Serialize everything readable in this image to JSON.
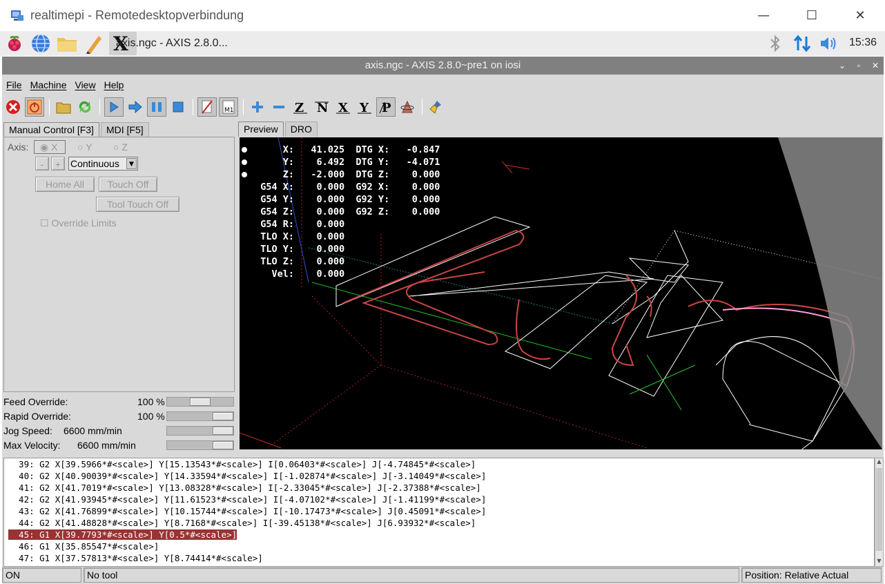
{
  "rdp_window": {
    "title": "realtimepi - Remotedesktopverbindung",
    "minimize": "—",
    "maximize": "☐",
    "close": "✕"
  },
  "taskbar": {
    "task_label": "axis.ngc - AXIS 2.8.0...",
    "clock": "15:36"
  },
  "window": {
    "title": "axis.ngc - AXIS 2.8.0~pre1 on iosi"
  },
  "menu": {
    "file": "File",
    "machine": "Machine",
    "view": "View",
    "help": "Help"
  },
  "left_tabs": {
    "manual": "Manual Control [F3]",
    "mdi": "MDI [F5]"
  },
  "manual": {
    "axis_label": "Axis:",
    "axes": [
      "X",
      "Y",
      "Z"
    ],
    "minus": "-",
    "plus": "+",
    "jog_mode": "Continuous",
    "home_all": "Home All",
    "touch_off": "Touch Off",
    "tool_touch_off": "Tool Touch Off",
    "override_limits": "Override Limits"
  },
  "overrides": {
    "feed_label": "Feed Override:",
    "feed_value": "100 %",
    "feed_fraction": 0.5,
    "rapid_label": "Rapid Override:",
    "rapid_value": "100 %",
    "rapid_fraction": 1.0,
    "jog_label": "Jog Speed:",
    "jog_value": "6600 mm/min",
    "jog_fraction": 1.0,
    "maxvel_label": "Max Velocity:",
    "maxvel_value": "6600 mm/min",
    "maxvel_fraction": 1.0
  },
  "right_tabs": {
    "preview": "Preview",
    "dro": "DRO"
  },
  "dro_lines": [
    "      X:   41.025  DTG X:   -0.847",
    "      Y:    6.492  DTG Y:   -4.071",
    "      Z:   -2.000  DTG Z:    0.000",
    "  G54 X:    0.000  G92 X:    0.000",
    "  G54 Y:    0.000  G92 Y:    0.000",
    "  G54 Z:    0.000  G92 Z:    0.000",
    "  G54 R:    0.000",
    "  TLO X:    0.000",
    "  TLO Y:    0.000",
    "  TLO Z:    0.000",
    "    Vel:    0.000"
  ],
  "code_lines": [
    "  39: G2 X[39.5966*#<scale>] Y[15.13543*#<scale>] I[0.06403*#<scale>] J[-4.74845*#<scale>]",
    "  40: G2 X[40.90039*#<scale>] Y[14.33594*#<scale>] I[-1.02874*#<scale>] J[-3.14049*#<scale>]",
    "  41: G2 X[41.7019*#<scale>] Y[13.08328*#<scale>] I[-2.33045*#<scale>] J[-2.37388*#<scale>]",
    "  42: G2 X[41.93945*#<scale>] Y[11.61523*#<scale>] I[-4.07102*#<scale>] J[-1.41199*#<scale>]",
    "  43: G2 X[41.76899*#<scale>] Y[10.15744*#<scale>] I[-10.17473*#<scale>] J[0.45091*#<scale>]",
    "  44: G2 X[41.48828*#<scale>] Y[8.7168*#<scale>] I[-39.45138*#<scale>] J[6.93932*#<scale>]",
    "  45: G1 X[39.7793*#<scale>] Y[0.5*#<scale>]",
    "  46: G1 X[35.85547*#<scale>]",
    "  47: G1 X[37.57813*#<scale>] Y[8.74414*#<scale>]"
  ],
  "selected_code_line": 6,
  "status": {
    "state": "ON",
    "tool": "No tool",
    "position": "Position: Relative Actual"
  },
  "colors": {
    "titlebar": "#808080",
    "selection": "#993333",
    "toolpath": "#cc4444",
    "preview_bg": "#000000"
  }
}
